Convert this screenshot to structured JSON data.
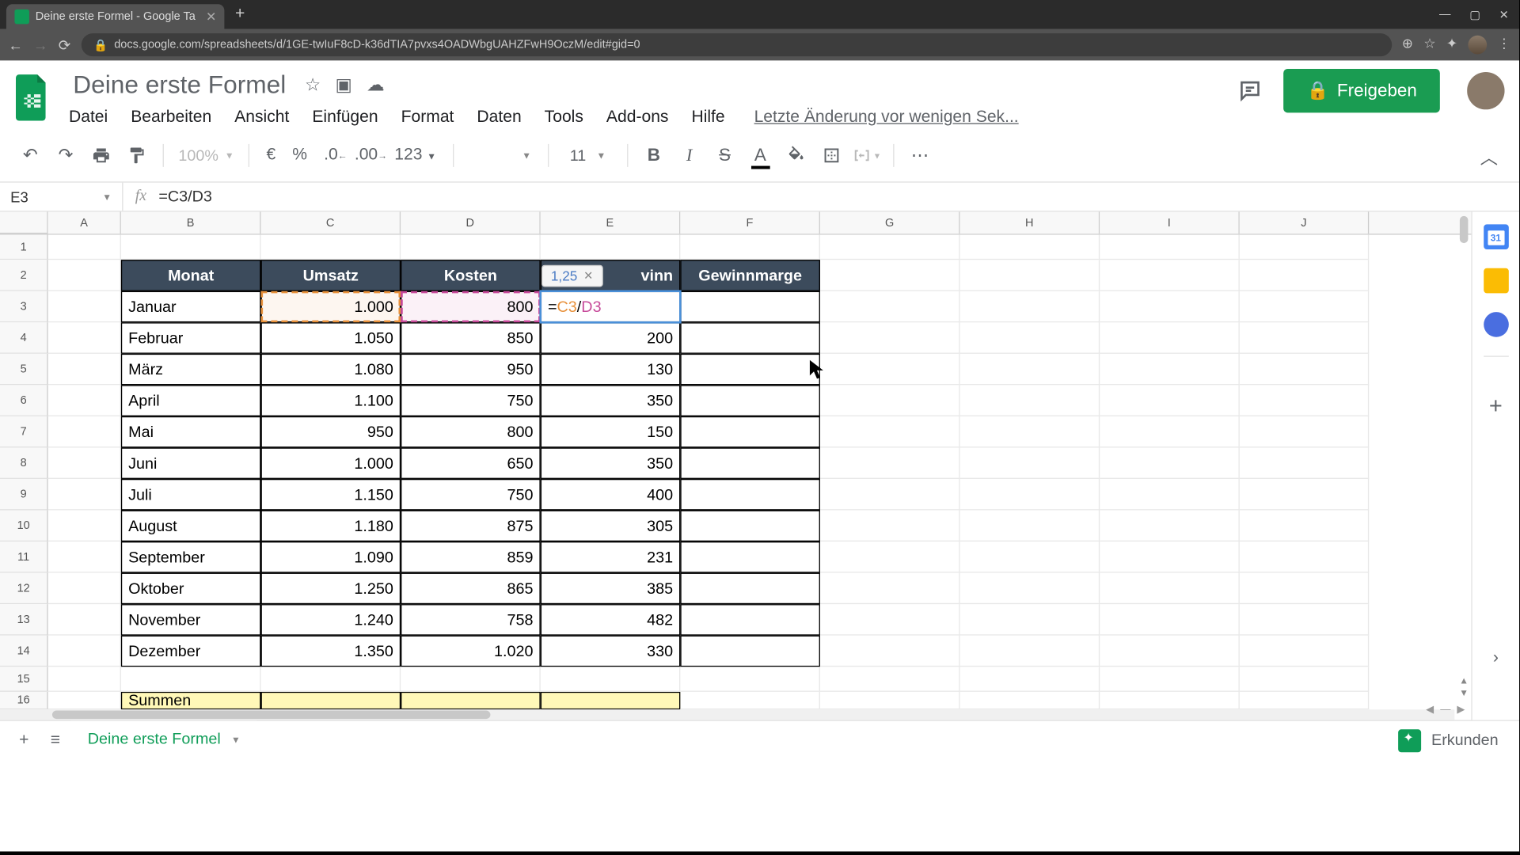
{
  "browser": {
    "tab_title": "Deine erste Formel - Google Ta",
    "url": "docs.google.com/spreadsheets/d/1GE-twIuF8cD-k36dTIA7pvxs4OADWbgUAHZFwH9OczM/edit#gid=0"
  },
  "doc": {
    "title": "Deine erste Formel",
    "last_edit": "Letzte Änderung vor wenigen Sek..."
  },
  "menu": {
    "file": "Datei",
    "edit": "Bearbeiten",
    "view": "Ansicht",
    "insert": "Einfügen",
    "format": "Format",
    "data": "Daten",
    "tools": "Tools",
    "addons": "Add-ons",
    "help": "Hilfe"
  },
  "share_btn": "Freigeben",
  "toolbar": {
    "zoom": "100%",
    "currency": "€",
    "percent": "%",
    "dec_less": ".0",
    "dec_more": ".00",
    "num_format": "123",
    "font_size": "11"
  },
  "namebox": "E3",
  "formula": "=C3/D3",
  "preview": "1,25",
  "cols": [
    "A",
    "B",
    "C",
    "D",
    "E",
    "F",
    "G",
    "H",
    "I",
    "J"
  ],
  "headers": {
    "monat": "Monat",
    "umsatz": "Umsatz",
    "kosten": "Kosten",
    "gewinn": "Gewinn",
    "gewinn_visible": "vinn",
    "marge": "Gewinnmarge"
  },
  "data_rows": [
    {
      "m": "Januar",
      "u": "1.000",
      "k": "800",
      "g": ""
    },
    {
      "m": "Februar",
      "u": "1.050",
      "k": "850",
      "g": "200"
    },
    {
      "m": "März",
      "u": "1.080",
      "k": "950",
      "g": "130"
    },
    {
      "m": "April",
      "u": "1.100",
      "k": "750",
      "g": "350"
    },
    {
      "m": "Mai",
      "u": "950",
      "k": "800",
      "g": "150"
    },
    {
      "m": "Juni",
      "u": "1.000",
      "k": "650",
      "g": "350"
    },
    {
      "m": "Juli",
      "u": "1.150",
      "k": "750",
      "g": "400"
    },
    {
      "m": "August",
      "u": "1.180",
      "k": "875",
      "g": "305"
    },
    {
      "m": "September",
      "u": "1.090",
      "k": "859",
      "g": "231"
    },
    {
      "m": "Oktober",
      "u": "1.250",
      "k": "865",
      "g": "385"
    },
    {
      "m": "November",
      "u": "1.240",
      "k": "758",
      "g": "482"
    },
    {
      "m": "Dezember",
      "u": "1.350",
      "k": "1.020",
      "g": "330"
    }
  ],
  "editing_formula": {
    "eq": "=",
    "r1": "C3",
    "op": "/",
    "r2": "D3"
  },
  "summen": "Summen",
  "sheet_name": "Deine erste Formel",
  "explore": "Erkunden"
}
